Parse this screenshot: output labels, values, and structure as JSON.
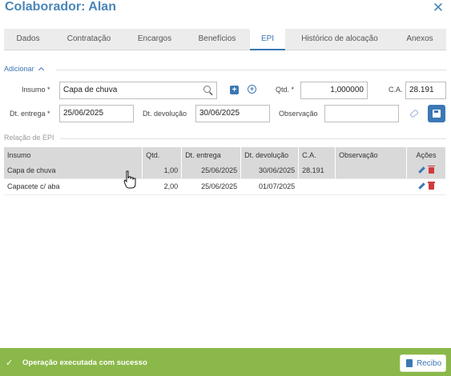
{
  "header": {
    "title": "Colaborador: Alan",
    "close_glyph": "✕"
  },
  "tabs": [
    {
      "label": "Dados",
      "active": false
    },
    {
      "label": "Contratação",
      "active": false
    },
    {
      "label": "Encargos",
      "active": false
    },
    {
      "label": "Benefícios",
      "active": false
    },
    {
      "label": "EPI",
      "active": true
    },
    {
      "label": "Histórico de alocação",
      "active": false
    },
    {
      "label": "Anexos",
      "active": false
    }
  ],
  "form": {
    "section_title": "Adicionar",
    "insumo": {
      "label": "Insumo *",
      "value": "Capa de chuva"
    },
    "qtd": {
      "label": "Qtd. *",
      "value": "1,000000"
    },
    "ca": {
      "label": "C.A.",
      "value": "28.191"
    },
    "dt_entrega": {
      "label": "Dt. entrega *",
      "value": "25/06/2025"
    },
    "dt_devolucao": {
      "label": "Dt. devolução",
      "value": "30/06/2025"
    },
    "observacao": {
      "label": "Observação",
      "value": ""
    }
  },
  "table": {
    "section_title": "Relação de EPI",
    "headers": {
      "insumo": "Insumo",
      "qtd": "Qtd.",
      "dt_entrega": "Dt. entrega",
      "dt_devolucao": "Dt. devolução",
      "ca": "C.A.",
      "observacao": "Observação",
      "acoes": "Ações"
    },
    "rows": [
      {
        "insumo": "Capa de chuva",
        "qtd": "1,00",
        "dt_entrega": "25/06/2025",
        "dt_devolucao": "30/06/2025",
        "ca": "28.191",
        "observacao": ""
      },
      {
        "insumo": "Capacete c/ aba",
        "qtd": "2,00",
        "dt_entrega": "25/06/2025",
        "dt_devolucao": "01/07/2025",
        "ca": "",
        "observacao": ""
      }
    ]
  },
  "toast": {
    "message": "Operação executada com sucesso",
    "check_glyph": "✓",
    "button_label": "Recibo"
  },
  "colors": {
    "accent": "#3b78b5",
    "success": "#8bb84a",
    "delete": "#d03a3a"
  },
  "icons": [
    "close-icon",
    "chevron-up-icon",
    "search-icon",
    "add-square-icon",
    "add-circle-icon",
    "eraser-icon",
    "save-icon",
    "edit-icon",
    "delete-icon",
    "check-icon",
    "receipt-icon",
    "hand-cursor-icon"
  ]
}
